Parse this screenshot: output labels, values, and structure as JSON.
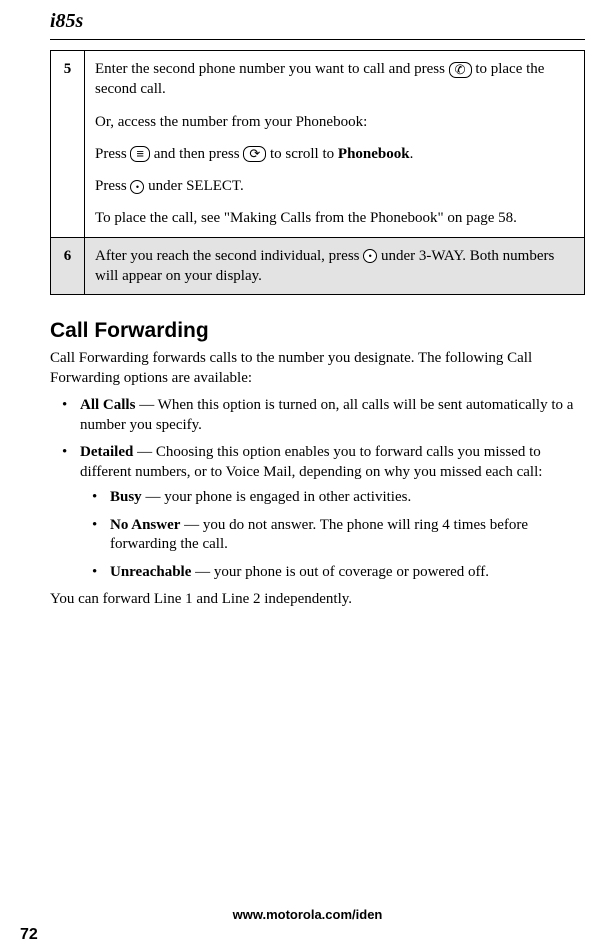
{
  "header": {
    "model": "i85s"
  },
  "steps": [
    {
      "num": "5",
      "shaded": false,
      "paras": [
        {
          "segments": [
            {
              "text": "Enter the second phone number you want to call and press "
            },
            {
              "icon": "call-icon",
              "glyph": "✆"
            },
            {
              "text": " to place the second call."
            }
          ]
        },
        {
          "segments": [
            {
              "text": "Or, access the number from your Phonebook:"
            }
          ]
        },
        {
          "segments": [
            {
              "text": "Press "
            },
            {
              "icon": "menu-icon",
              "glyph": "≡"
            },
            {
              "text": " and then press "
            },
            {
              "icon": "scroll-icon",
              "glyph": "⟳"
            },
            {
              "text": " to scroll to "
            },
            {
              "bold": "Phonebook"
            },
            {
              "text": "."
            }
          ]
        },
        {
          "segments": [
            {
              "text": "Press "
            },
            {
              "icon": "select-icon",
              "glyph": "•"
            },
            {
              "text": " under SELECT."
            }
          ]
        },
        {
          "segments": [
            {
              "text": "To place the call, see \"Making Calls from the Phonebook\" on page 58."
            }
          ]
        }
      ]
    },
    {
      "num": "6",
      "shaded": true,
      "paras": [
        {
          "segments": [
            {
              "text": "After you reach the second individual, press "
            },
            {
              "icon": "option-icon",
              "glyph": "•"
            },
            {
              "text": " under 3-WAY. Both numbers will appear on your display."
            }
          ]
        }
      ]
    }
  ],
  "section": {
    "title": "Call Forwarding",
    "intro": "Call Forwarding forwards calls to the number you designate. The following Call Forwarding options are available:",
    "bullets": [
      {
        "label": "All Calls",
        "text": " — When this option is turned on, all calls will be sent automatically to a number you specify."
      },
      {
        "label": "Detailed",
        "text": " — Choosing this option enables you to forward calls you missed to different numbers, or to Voice Mail, depending on why you missed each call:",
        "sub": [
          {
            "label": "Busy",
            "text": " — your phone is engaged in other activities."
          },
          {
            "label": "No Answer",
            "text": " — you do not answer. The phone will ring 4 times before forwarding the call."
          },
          {
            "label": "Unreachable",
            "text": " — your phone is out of coverage or powered off."
          }
        ]
      }
    ],
    "outro": "You can forward Line 1 and Line 2 independently."
  },
  "footer": {
    "url": "www.motorola.com/iden",
    "page": "72"
  }
}
